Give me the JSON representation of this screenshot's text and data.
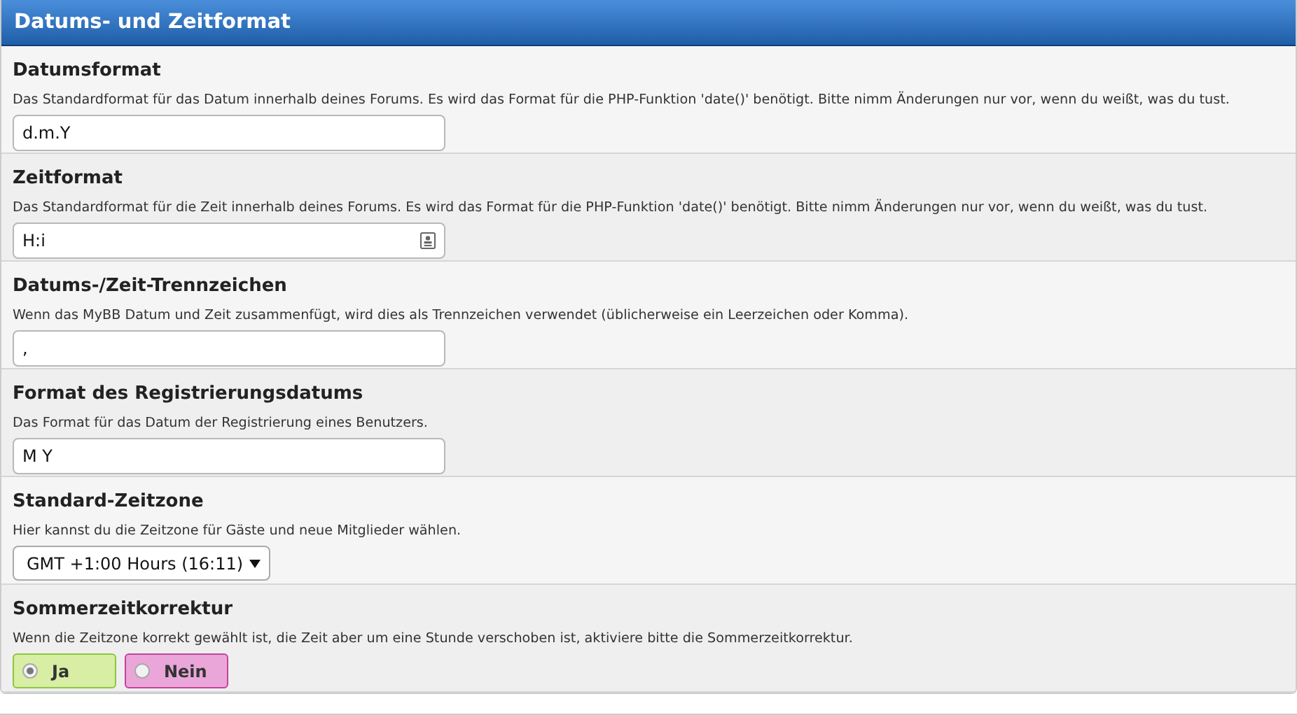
{
  "panel": {
    "title": "Datums- und Zeitformat"
  },
  "settings": [
    {
      "kind": "text",
      "label": "Datumsformat",
      "description": "Das Standardformat für das Datum innerhalb deines Forums. Es wird das Format für die PHP-Funktion 'date()' benötigt. Bitte nimm Änderungen nur vor, wenn du weißt, was du tust.",
      "value": "d.m.Y"
    },
    {
      "kind": "text",
      "label": "Zeitformat",
      "description": "Das Standardformat für die Zeit innerhalb deines Forums. Es wird das Format für die PHP-Funktion 'date()' benötigt. Bitte nimm Änderungen nur vor, wenn du weißt, was du tust.",
      "value": "H:i",
      "autofill": true
    },
    {
      "kind": "text",
      "label": "Datums-/Zeit-Trennzeichen",
      "description": "Wenn das MyBB Datum und Zeit zusammenfügt, wird dies als Trennzeichen verwendet (üblicherweise ein Leerzeichen oder Komma).",
      "value": ","
    },
    {
      "kind": "text",
      "label": "Format des Registrierungsdatums",
      "description": "Das Format für das Datum der Registrierung eines Benutzers.",
      "value": "M Y"
    },
    {
      "kind": "select",
      "label": "Standard-Zeitzone",
      "description": "Hier kannst du die Zeitzone für Gäste und neue Mitglieder wählen.",
      "value": "GMT +1:00 Hours (16:11)"
    },
    {
      "kind": "yesno",
      "label": "Sommerzeitkorrektur",
      "description": "Wenn die Zeitzone korrekt gewählt ist, die Zeit aber um eine Stunde verschoben ist, aktiviere bitte die Sommerzeitkorrektur.",
      "options": [
        {
          "label": "Ja",
          "selected": true,
          "color": "#d8eea4"
        },
        {
          "label": "Nein",
          "selected": false,
          "color": "#eaa6d8"
        }
      ]
    }
  ]
}
